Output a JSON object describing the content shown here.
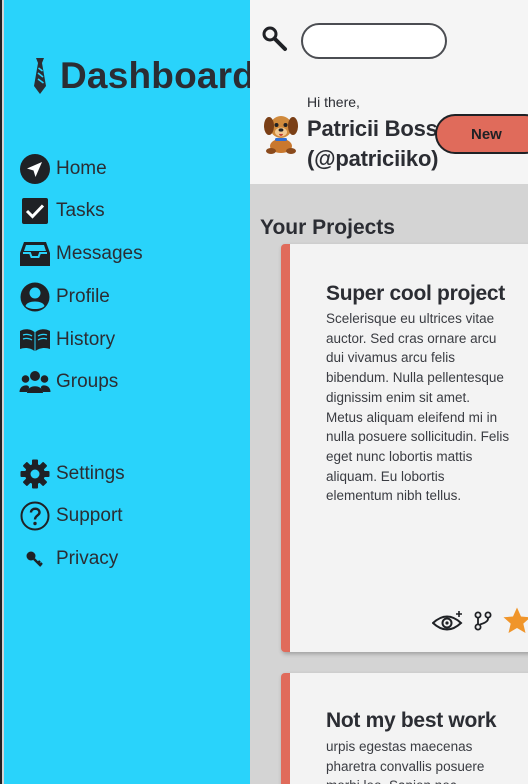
{
  "brand": {
    "title": "Dashboard",
    "icon": "tie-icon"
  },
  "sidebar": {
    "items": [
      {
        "label": "Home",
        "icon": "navigation-arrow-icon"
      },
      {
        "label": "Tasks",
        "icon": "checkbox-icon"
      },
      {
        "label": "Messages",
        "icon": "inbox-icon"
      },
      {
        "label": "Profile",
        "icon": "user-icon"
      },
      {
        "label": "History",
        "icon": "open-book-icon"
      },
      {
        "label": "Groups",
        "icon": "users-icon"
      },
      {
        "label": "Settings",
        "icon": "gear-icon"
      },
      {
        "label": "Support",
        "icon": "help-circle-icon"
      },
      {
        "label": "Privacy",
        "icon": "key-icon"
      }
    ]
  },
  "header": {
    "search": {
      "value": "",
      "placeholder": ""
    },
    "greeting": "Hi there,",
    "user_name": "Patricii Boss",
    "user_handle": "(@patriciiko)",
    "new_button": "New"
  },
  "main": {
    "section_title": "Your Projects",
    "projects": [
      {
        "title": "Super cool project",
        "description": "Scelerisque eu ultrices vitae auctor. Sed cras ornare arcu dui vivamus arcu felis bibendum. Nulla pellentesque dignissim enim sit amet. Metus aliquam eleifend mi in nulla posuere sollicitudin. Felis eget nunc lobortis mattis aliquam. Eu lobortis elementum nibh tellus."
      },
      {
        "title": "Not my best work",
        "description": "urpis egestas maecenas pharetra convallis posuere morbi leo. Sapien nec"
      }
    ]
  },
  "colors": {
    "sidebar": "#29d3fb",
    "accent": "#e06b5b",
    "star": "#f0952a",
    "text": "#2b2d33",
    "main_bg": "#d4d4d4"
  }
}
